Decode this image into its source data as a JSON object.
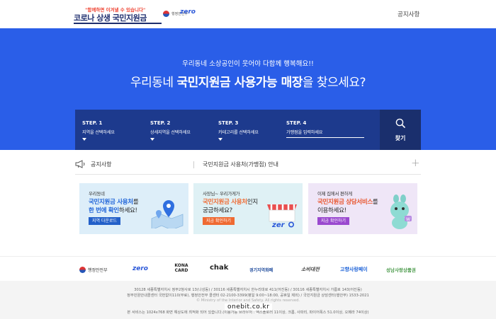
{
  "header": {
    "logo_tag": "\"함께하면 이겨낼 수 있습니다\"",
    "logo_title": "코로나 상생 국민지원금",
    "ministry_name": "행정안전부",
    "zero_logo": "zero",
    "notice_link": "공지사항"
  },
  "hero": {
    "subtitle": "우리동네 소상공인이 웃어야 다함께 행복해요!!",
    "title_pre": "우리동네 ",
    "title_bold": "국민지원금 사용가능 매장",
    "title_post": "을 찾으세요?",
    "background_color": "#2a5ee8"
  },
  "search": {
    "steps": [
      {
        "label": "STEP. 1",
        "desc": "지역을 선택하세요"
      },
      {
        "label": "STEP. 2",
        "desc": "상세지역을 선택하세요"
      },
      {
        "label": "STEP. 3",
        "desc": "카테고리를 선택하세요"
      },
      {
        "label": "STEP. 4",
        "placeholder": "가맹점을 입력하세요"
      }
    ],
    "find_label": "찾기",
    "find_icon": "search-icon"
  },
  "notice": {
    "label": "공지사항",
    "text": "국민지원금 사용처(가맹점) 안내",
    "more_icon": "plus-icon"
  },
  "cards": [
    {
      "l1": "우리동네",
      "l2_hl": "국민지원금 사용처",
      "l2_rest": "를",
      "l3_hl": "한 번에 확인",
      "l3_rest": "하세요!",
      "button": "지역 다운로드"
    },
    {
      "l1": "사장님~ 우리가게가",
      "l2_hl": "국민지원금 사용처",
      "l2_rest": "인지",
      "l3": "궁금하세요?",
      "button": "지금 확인하기"
    },
    {
      "l1": "이제 집에서 편하게",
      "l2_hl": "국민지원금 상담서비스",
      "l2_rest": "를",
      "l3": "이용하세요!",
      "button": "지금 확인하기"
    }
  ],
  "partners": [
    "행정안전부",
    "zero",
    "KONA CARD",
    "chak",
    "경기지역화폐",
    "소비대전",
    "고향사랑페이",
    "성남사랑상품권"
  ],
  "footer": {
    "line1": "30128 세종특별자치시 정부2청사로 13(나성동) / 30116 세종특별자치시 한누리대로 411(어진동) / 30116 세종특별자치시 가름로 143(어진동)",
    "line2": "정부민원안내콜센터 국번없이110(무료), 행정안전부 콜센터 02-2100-3399(평일 9:00~18:00, 공휴일 제외) / 국민지원금 상담센터(행안부) 1533-2021",
    "line3": "© Ministry of the Interior and Safety. All rights reserved.",
    "line4": "본 서비스는 1024x768 화면 해상도에 최적화 되어 있습니다.(이용가능 브라우저 : 엑스플로러 11이상, 크롬, 사파리, 파이어폭스 51.0이상, 오페라 74이상)"
  },
  "watermark": "onebit.co.kr"
}
